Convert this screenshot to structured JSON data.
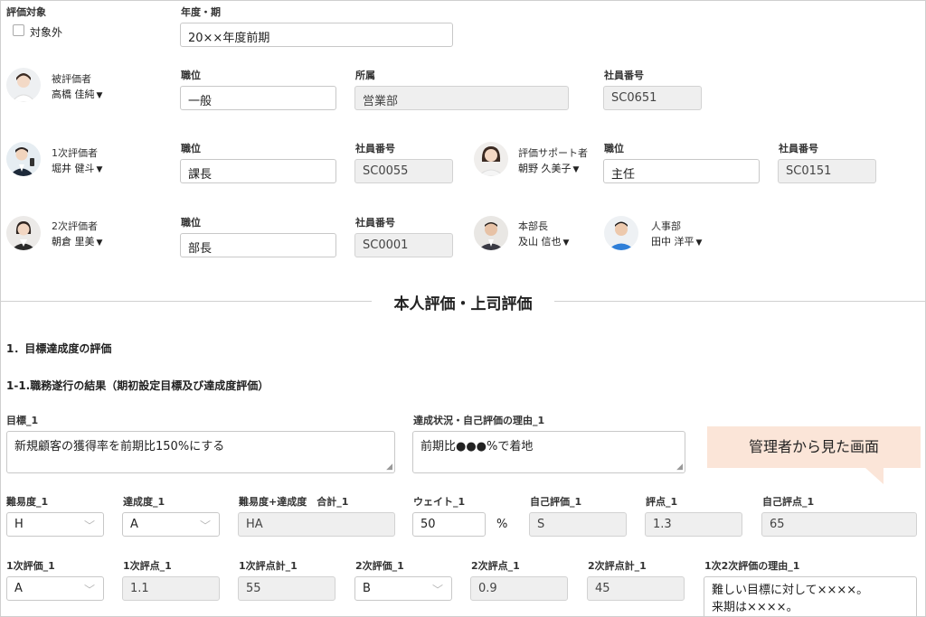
{
  "top": {
    "target_label": "評価対象",
    "exclude_label": "対象外",
    "period_label": "年度・期",
    "period_value": "20××年度前期"
  },
  "evaluatee": {
    "role": "被評価者",
    "name": "高橋 佳純",
    "pos_label": "職位",
    "pos_value": "一般",
    "dept_label": "所属",
    "dept_value": "営業部",
    "emp_label": "社員番号",
    "emp_value": "SC0651"
  },
  "first": {
    "role": "1次評価者",
    "name": "堀井 健斗",
    "pos_label": "職位",
    "pos_value": "課長",
    "emp_label": "社員番号",
    "emp_value": "SC0055"
  },
  "support": {
    "role": "評価サポート者",
    "name": "朝野 久美子",
    "pos_label": "職位",
    "pos_value": "主任",
    "emp_label": "社員番号",
    "emp_value": "SC0151"
  },
  "second": {
    "role": "2次評価者",
    "name": "朝倉 里美",
    "pos_label": "職位",
    "pos_value": "部長",
    "emp_label": "社員番号",
    "emp_value": "SC0001"
  },
  "head": {
    "role": "本部長",
    "name": "及山 信也"
  },
  "hr": {
    "role": "人事部",
    "name": "田中 洋平"
  },
  "section_title": "本人評価・上司評価",
  "h1": "1．目標達成度の評価",
  "h2": "1-1.職務遂行の結果（期初設定目標及び達成度評価）",
  "goal": {
    "goal_label": "目標_1",
    "goal_value": "新規顧客の獲得率を前期比150%にする",
    "status_label": "達成状況・自己評価の理由_1",
    "status_value": "前期比●●●%で着地"
  },
  "callout": "管理者から見た画面",
  "row1": {
    "difficulty_label": "難易度_1",
    "difficulty_value": "H",
    "achievement_label": "達成度_1",
    "achievement_value": "A",
    "total_label": "難易度+達成度　合計_1",
    "total_value": "HA",
    "weight_label": "ウェイト_1",
    "weight_value": "50",
    "weight_unit": "%",
    "self_label": "自己評価_1",
    "self_value": "S",
    "score_label": "評点_1",
    "score_value": "1.3",
    "self_score_label": "自己評点_1",
    "self_score_value": "65"
  },
  "row2": {
    "eval1_label": "1次評価_1",
    "eval1_value": "A",
    "score1_label": "1次評点_1",
    "score1_value": "1.1",
    "sum1_label": "1次評点計_1",
    "sum1_value": "55",
    "eval2_label": "2次評価_1",
    "eval2_value": "B",
    "score2_label": "2次評点_1",
    "score2_value": "0.9",
    "sum2_label": "2次評点計_1",
    "sum2_value": "45",
    "reason_label": "1次2次評価の理由_1",
    "reason_line1": "難しい目標に対して××××。",
    "reason_line2": "来期は××××。"
  },
  "colors": {
    "callout_bg": "#fbe5d8",
    "readonly_bg": "#efefef"
  }
}
